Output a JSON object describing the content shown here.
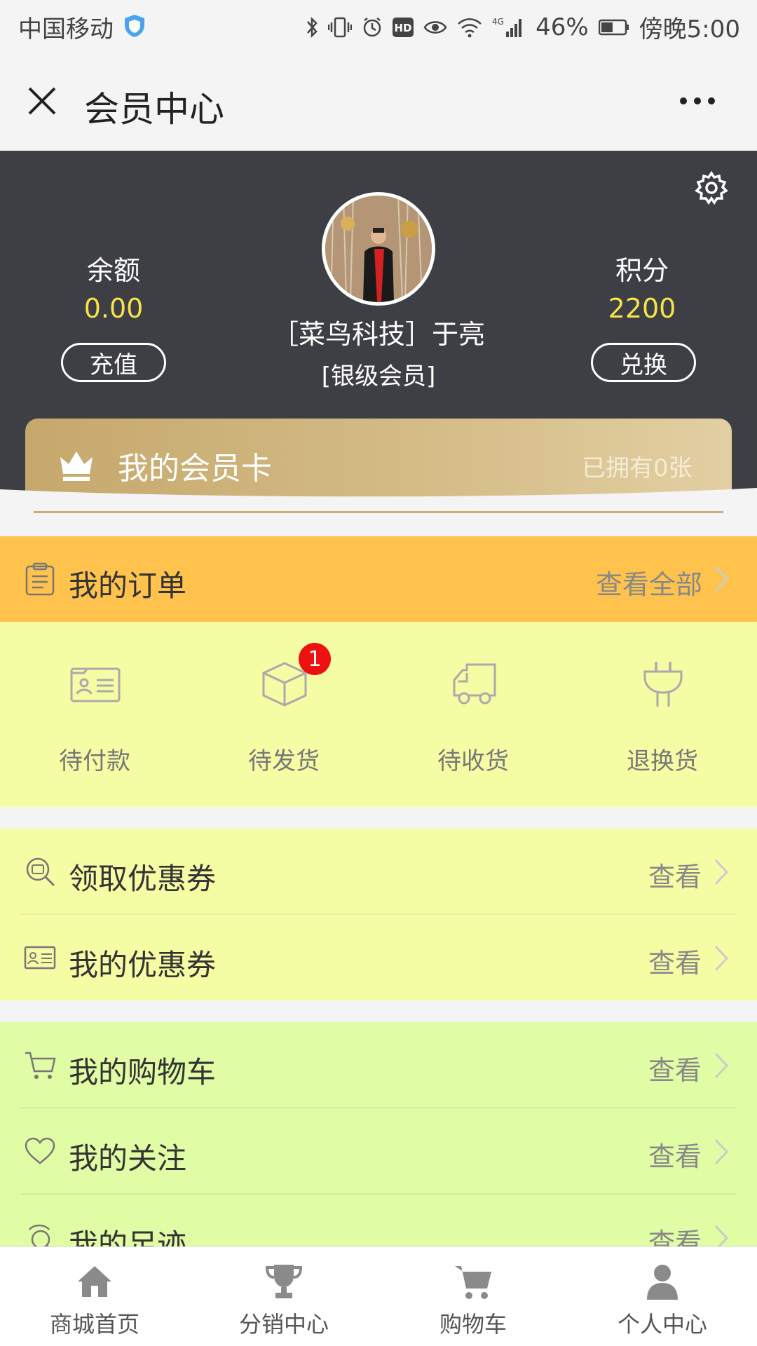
{
  "status_bar": {
    "carrier": "中国移动",
    "network": "4G",
    "battery": "46%",
    "time": "傍晚5:00"
  },
  "header": {
    "title": "会员中心"
  },
  "member": {
    "balance_label": "余额",
    "balance_value": "0.00",
    "recharge_label": "充值",
    "points_label": "积分",
    "points_value": "2200",
    "exchange_label": "兑换",
    "name": "［菜鸟科技］于亮",
    "level": "[银级会员]"
  },
  "member_card": {
    "title": "我的会员卡",
    "count": "已拥有0张"
  },
  "orders": {
    "title": "我的订单",
    "view_all": "查看全部",
    "statuses": [
      {
        "label": "待付款",
        "icon": "card-icon"
      },
      {
        "label": "待发货",
        "icon": "box-icon",
        "badge": "1"
      },
      {
        "label": "待收货",
        "icon": "truck-icon"
      },
      {
        "label": "退换货",
        "icon": "plug-icon"
      }
    ]
  },
  "coupon_rows": [
    {
      "label": "领取优惠券",
      "action": "查看",
      "icon": "coupon-search-icon"
    },
    {
      "label": "我的优惠券",
      "action": "查看",
      "icon": "coupon-card-icon"
    }
  ],
  "other_rows": [
    {
      "label": "我的购物车",
      "action": "查看",
      "icon": "cart-icon"
    },
    {
      "label": "我的关注",
      "action": "查看",
      "icon": "heart-icon"
    },
    {
      "label": "我的足迹",
      "action": "查看",
      "icon": "footprint-icon"
    }
  ],
  "bottom_nav": [
    {
      "label": "商城首页",
      "icon": "home-icon"
    },
    {
      "label": "分销中心",
      "icon": "trophy-icon"
    },
    {
      "label": "购物车",
      "icon": "cart-icon"
    },
    {
      "label": "个人中心",
      "icon": "person-icon"
    }
  ],
  "colors": {
    "header_bg": "#3d3f44",
    "accent_yellow": "#f6e24a",
    "orders_header": "#ffc34d",
    "section_yellow": "#f4fca4",
    "section_green": "#e0fca4",
    "badge_red": "#ee1111",
    "card_gold": "#c5a86c"
  }
}
